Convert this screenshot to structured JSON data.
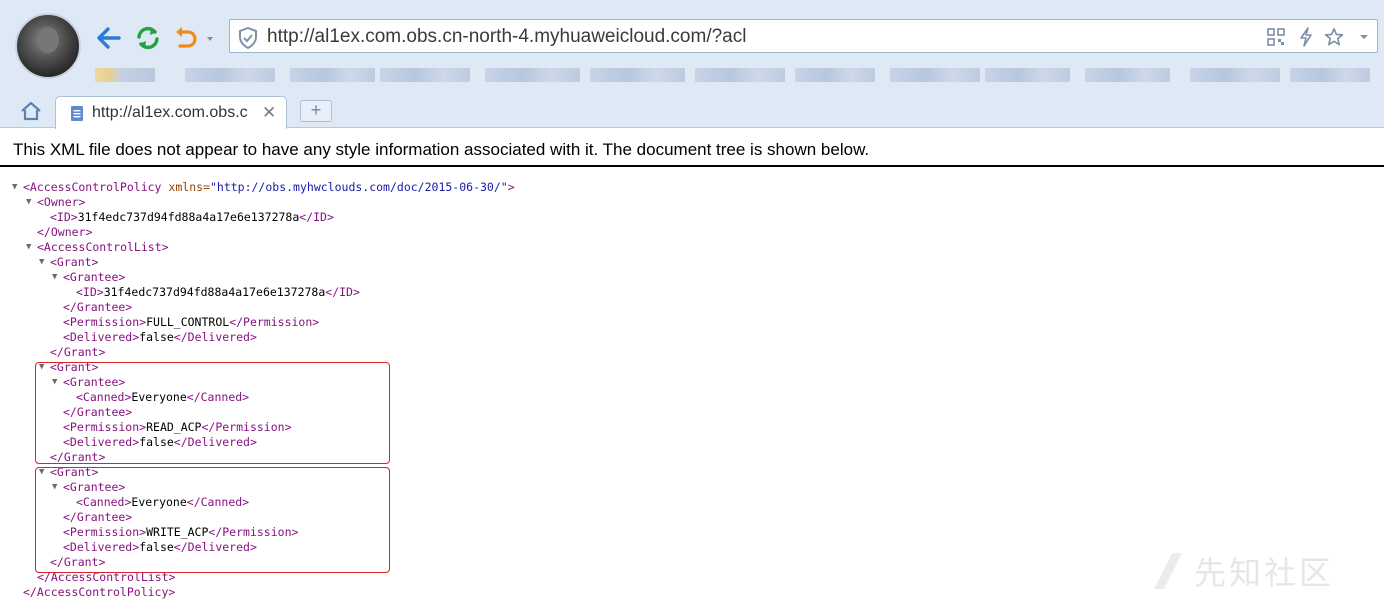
{
  "browser": {
    "address": "http://al1ex.com.obs.cn-north-4.myhuaweicloud.com/?acl",
    "tab_title": "http://al1ex.com.obs.c",
    "tab_close": "✕",
    "new_tab": "+",
    "icons": {
      "back": "back-arrow-icon",
      "refresh": "refresh-icon",
      "undo": "undo-icon",
      "security": "shield-icon",
      "qr": "qr-code-icon",
      "speed": "lightning-icon",
      "favorite": "star-icon",
      "menu": "chevron-down-icon",
      "home": "home-icon",
      "page": "page-icon"
    }
  },
  "page": {
    "notice": "This XML file does not appear to have any style information associated with it. The document tree is shown below."
  },
  "xml": {
    "root_open": "<AccessControlPolicy",
    "xmlns_attr": "xmlns=",
    "xmlns_value": "\"http://obs.myhwclouds.com/doc/2015-06-30/\"",
    "root_open_end": ">",
    "owner_open": "<Owner>",
    "id_open": "<ID>",
    "owner_id": "31f4edc737d94fd88a4a17e6e137278a",
    "id_close": "</ID>",
    "owner_close": "</Owner>",
    "acl_open": "<AccessControlList>",
    "grant_open": "<Grant>",
    "grantee_open": "<Grantee>",
    "grantee_id": "31f4edc737d94fd88a4a17e6e137278a",
    "grantee_close": "</Grantee>",
    "permission_open": "<Permission>",
    "permission_close": "</Permission>",
    "perm_full": "FULL_CONTROL",
    "delivered_open": "<Delivered>",
    "delivered_value": "false",
    "delivered_close": "</Delivered>",
    "grant_close": "</Grant>",
    "canned_open": "<Canned>",
    "canned_value": "Everyone",
    "canned_close": "</Canned>",
    "perm_read_acp": "READ_ACP",
    "perm_write_acp": "WRITE_ACP",
    "acl_close": "</AccessControlList>",
    "root_close": "</AccessControlPolicy>",
    "toggle": "▼"
  },
  "watermark": "先知社区",
  "colors": {
    "tag": "#881280",
    "attr_name": "#994500",
    "attr_value": "#1a1aa6",
    "highlight_border": "#d7252a",
    "chrome_bg": "#dfe9f6"
  }
}
